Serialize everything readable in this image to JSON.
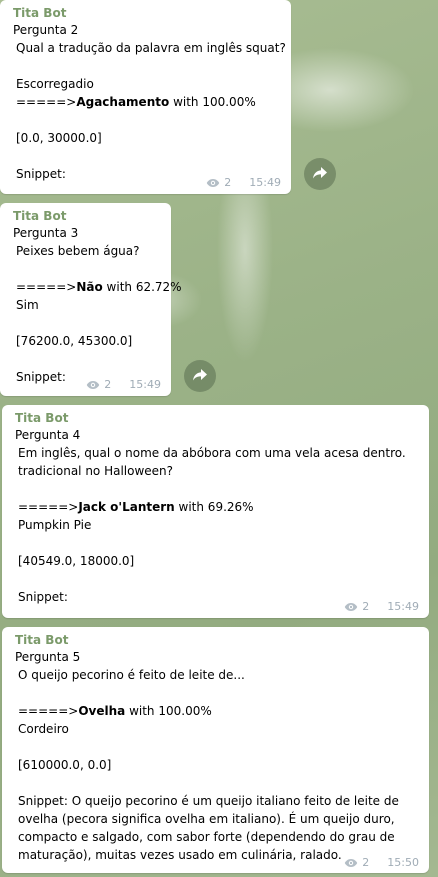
{
  "messages": [
    {
      "sender": "Tita Bot",
      "question_no": "Pergunta 2",
      "question": "Qual a tradução da palavra em inglês squat?",
      "options_before": [
        "Escorregadio"
      ],
      "answer_prefix": "=====>",
      "answer": "Agachamento",
      "confidence": "with 100.00%",
      "options_after": [],
      "scores": "[0.0, 30000.0]",
      "snippet": "Snippet:",
      "views": "2",
      "time": "15:49"
    },
    {
      "sender": "Tita Bot",
      "question_no": "Pergunta 3",
      "question": "Peixes bebem água?",
      "options_before": [],
      "answer_prefix": "=====>",
      "answer": "Não",
      "confidence": "with 62.72%",
      "options_after": [
        "Sim"
      ],
      "scores": "[76200.0, 45300.0]",
      "snippet": "Snippet:",
      "views": "2",
      "time": "15:49"
    },
    {
      "sender": "Tita Bot",
      "question_no": "Pergunta 4",
      "question": "Em inglês, qual o nome da abóbora com uma vela acesa dentro. tradicional no Halloween?",
      "options_before": [],
      "answer_prefix": "=====>",
      "answer": "Jack o'Lantern",
      "confidence": "with 69.26%",
      "options_after": [
        "Pumpkin Pie"
      ],
      "scores": "[40549.0, 18000.0]",
      "snippet": "Snippet:",
      "views": "2",
      "time": "15:49"
    },
    {
      "sender": "Tita Bot",
      "question_no": "Pergunta 5",
      "question": "O queijo pecorino é feito de leite de...",
      "options_before": [],
      "answer_prefix": "=====>",
      "answer": "Ovelha",
      "confidence": "with 100.00%",
      "options_after": [
        "Cordeiro"
      ],
      "scores": "[610000.0, 0.0]",
      "snippet": "Snippet: O queijo pecorino é um queijo italiano feito de leite de ovelha (pecora significa ovelha em italiano). É um queijo duro, compacto e salgado, com sabor forte (dependendo do grau de maturação), muitas vezes usado em culinária, ralado.",
      "views": "2",
      "time": "15:50"
    }
  ],
  "colors": {
    "sender": "#7b9a6a",
    "meta": "#a0acb6",
    "bubble": "#ffffff"
  }
}
